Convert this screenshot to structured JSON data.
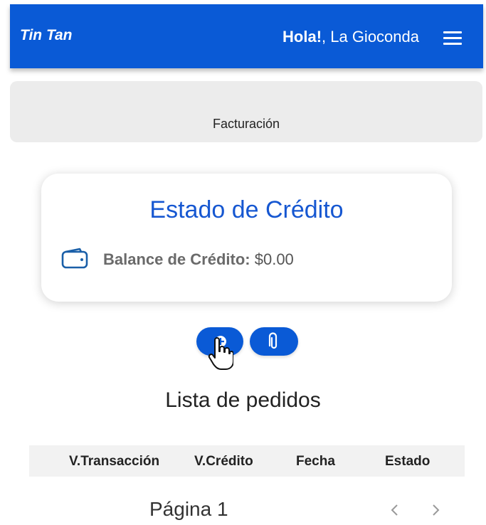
{
  "header": {
    "brand": "Tin Tan",
    "greeting_bold": "Hola!",
    "greeting_rest": ", La Gioconda",
    "menu_icon": "hamburger-menu-icon"
  },
  "subheader": {
    "title": "Facturación"
  },
  "credit_card": {
    "title": "Estado de Crédito",
    "balance_label": "Balance de Crédito:",
    "balance_value": "$0.00",
    "icon": "wallet-icon"
  },
  "actions": {
    "add_icon": "plus-icon",
    "attach_icon": "paperclip-icon"
  },
  "orders": {
    "title": "Lista de pedidos",
    "columns": [
      "V.Transacción",
      "V.Crédito",
      "Fecha",
      "Estado"
    ]
  },
  "pagination": {
    "label": "Página 1",
    "prev_icon": "chevron-left-icon",
    "next_icon": "chevron-right-icon"
  },
  "colors": {
    "primary": "#0a5ad6",
    "title_blue": "#1657d1",
    "subbar_bg": "#ececec",
    "table_head_bg": "#f2f2f2"
  }
}
